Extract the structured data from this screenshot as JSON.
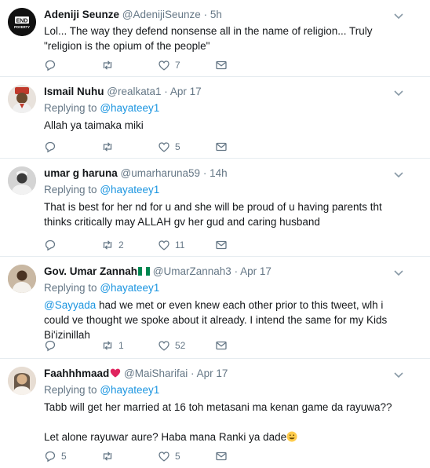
{
  "tweets": [
    {
      "name": "Adeniji Seunze",
      "handle": "@AdenijiSeunze",
      "time": "5h",
      "avatar_badge": "END POVERTY",
      "text": "Lol... The way they defend nonsense all in the name of religion... Truly \"religion is the opium of the people\"",
      "replies": "",
      "retweets": "",
      "likes": "7"
    },
    {
      "name": "Ismail Nuhu",
      "handle": "@realkata1",
      "time": "Apr 17",
      "replying_prefix": "Replying to",
      "replying_to": "@hayateey1",
      "text": "Allah ya taimaka miki",
      "replies": "",
      "retweets": "",
      "likes": "5"
    },
    {
      "name": "umar g haruna",
      "handle": "@umarharuna59",
      "time": "14h",
      "replying_prefix": "Replying to",
      "replying_to": "@hayateey1",
      "text": "That is best for her nd for u and she will be proud of u having parents tht thinks critically may ALLAH gv her gud and caring husband",
      "replies": "",
      "retweets": "2",
      "likes": "11"
    },
    {
      "name": "Gov. Umar Zannah",
      "handle": "@UmarZannah3",
      "time": "Apr 17",
      "replying_prefix": "Replying to",
      "replying_to": "@hayateey1",
      "text_mention": "@Sayyada",
      "text": " had we met or even knew each other prior to this tweet, wlh i could ve thought we spoke about it already. I intend the same for my Kids Bi'izinillah",
      "replies": "",
      "retweets": "1",
      "likes": "52"
    },
    {
      "name": "Faahhhmaad",
      "handle": "@MaiSharifai",
      "time": "Apr 17",
      "replying_prefix": "Replying to",
      "replying_to": "@hayateey1",
      "text_line1": "Tabb will get her married at 16 toh metasani ma kenan game da rayuwa??",
      "text_line2": "Let alone rayuwar aure? Haba mana Ranki ya dade",
      "replies": "5",
      "retweets": "",
      "likes": "5"
    }
  ],
  "colors": {
    "link": "#1b95e0",
    "secondary": "#657786",
    "border": "#e6ecf0"
  },
  "icons": [
    "reply-icon",
    "retweet-icon",
    "like-icon",
    "direct-message-icon",
    "chevron-down-icon"
  ]
}
